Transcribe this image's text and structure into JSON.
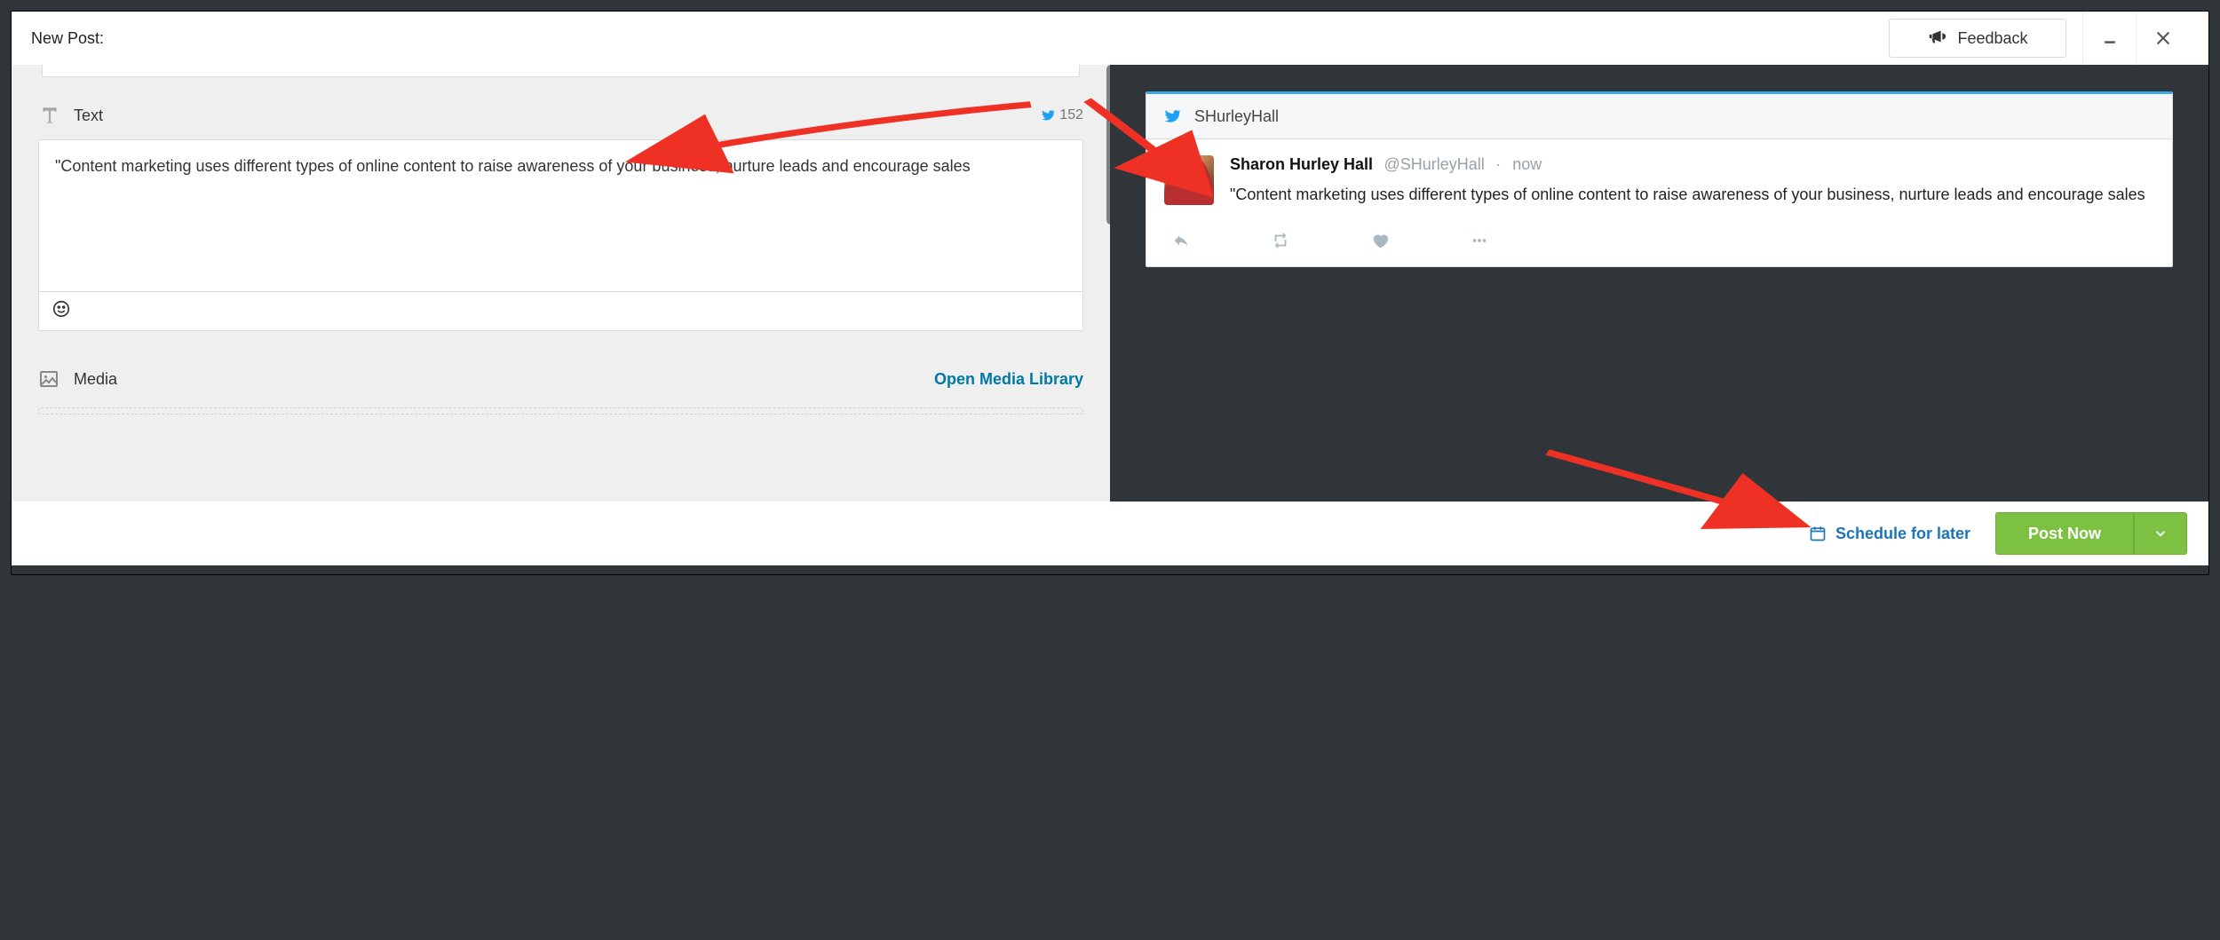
{
  "header": {
    "title": "New Post:",
    "feedback_label": "Feedback"
  },
  "compose": {
    "text_section_label": "Text",
    "char_count": "152",
    "content": "\"Content marketing uses different types of online content to raise awareness of your business, nurture leads and encourage sales",
    "media_section_label": "Media",
    "open_media_label": "Open Media Library"
  },
  "preview": {
    "account_handle": "SHurleyHall",
    "display_name": "Sharon Hurley Hall",
    "at_handle": "@SHurleyHall",
    "time_sep": " · ",
    "time_label": "now",
    "tweet_text": "\"Content marketing uses different types of online content to raise awareness of your business, nurture leads and encourage sales"
  },
  "footer": {
    "schedule_label": "Schedule for later",
    "post_label": "Post Now"
  },
  "colors": {
    "twitter": "#1da1f2",
    "link": "#0078a8",
    "green": "#7cc142",
    "red_arrow": "#ee3124"
  }
}
